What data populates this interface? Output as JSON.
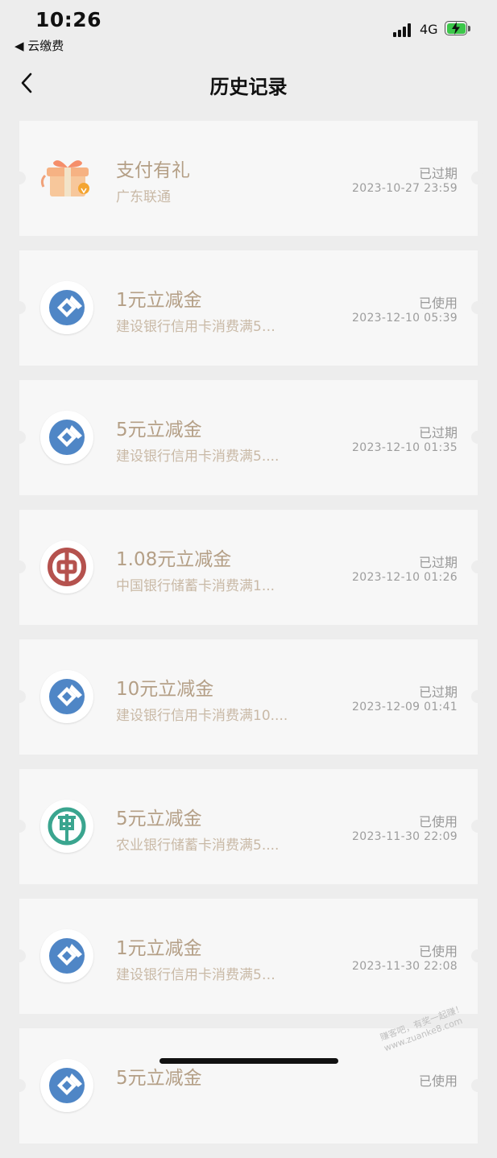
{
  "status_bar": {
    "time": "10:26",
    "back_app": "◀ 云缴费",
    "network": "4G"
  },
  "nav": {
    "title": "历史记录"
  },
  "records": [
    {
      "logo": "gift-icon",
      "title": "支付有礼",
      "subtitle": "广东联通",
      "status": "已过期",
      "time": "2023-10-27 23:59"
    },
    {
      "logo": "ccb-logo-icon",
      "title": "1元立减金",
      "subtitle": "建设银行信用卡消费满5…",
      "status": "已使用",
      "time": "2023-12-10 05:39"
    },
    {
      "logo": "ccb-logo-icon",
      "title": "5元立减金",
      "subtitle": "建设银行信用卡消费满5....",
      "status": "已过期",
      "time": "2023-12-10 01:35"
    },
    {
      "logo": "boc-logo-icon",
      "title": "1.08元立减金",
      "subtitle": "中国银行储蓄卡消费满1...",
      "status": "已过期",
      "time": "2023-12-10 01:26"
    },
    {
      "logo": "ccb-logo-icon",
      "title": "10元立减金",
      "subtitle": "建设银行信用卡消费满10....",
      "status": "已过期",
      "time": "2023-12-09 01:41"
    },
    {
      "logo": "abc-logo-icon",
      "title": "5元立减金",
      "subtitle": "农业银行储蓄卡消费满5....",
      "status": "已使用",
      "time": "2023-11-30 22:09"
    },
    {
      "logo": "ccb-logo-icon",
      "title": "1元立减金",
      "subtitle": "建设银行信用卡消费满5…",
      "status": "已使用",
      "time": "2023-11-30 22:08"
    },
    {
      "logo": "ccb-logo-icon",
      "title": "5元立减金",
      "subtitle": "",
      "status": "已使用",
      "time": ""
    }
  ],
  "watermark": "赚客吧，有奖一起赚！ www.zuanke8.com",
  "colors": {
    "title": "#b49f86",
    "subtitle": "#c9b9a6",
    "ccb": "#4f86c6",
    "boc": "#b5524e",
    "abc": "#3aa58f"
  }
}
